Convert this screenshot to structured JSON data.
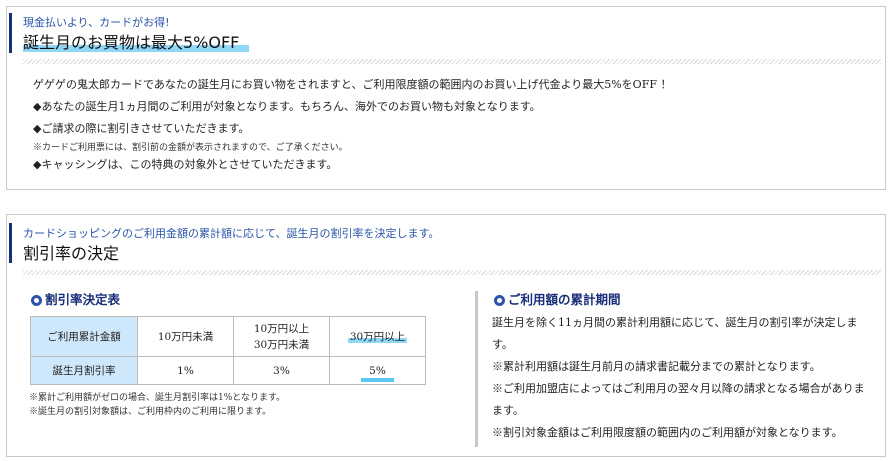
{
  "section1": {
    "subtitle": "現金払いより、カードがお得!",
    "title": "誕生月のお買物は最大5%OFF",
    "lines": [
      "ゲゲゲの鬼太郎カードであなたの誕生月にお買い物をされますと、ご利用限度額の範囲内のお買い上げ代金より最大5%をOFF ！",
      "◆あなたの誕生月1ヵ月間のご利用が対象となります。もちろん、海外でのお買い物も対象となります。",
      "◆ご請求の際に割引きさせていただきます。",
      "※カードご利用票には、割引前の金額が表示されますので、ご了承ください。",
      "◆キャッシングは、この特典の対象外とさせていただきます。"
    ]
  },
  "section2": {
    "subtitle": "カードショッピングのご利用金額の累計額に応じて、誕生月の割引率を決定します。",
    "title": "割引率の決定",
    "table_title": "割引率決定表",
    "table": {
      "row1": [
        "ご利用累計金額",
        "10万円未満",
        "10万円以上\n30万円未満",
        "30万円以上"
      ],
      "row2": [
        "誕生月割引率",
        "1%",
        "3%",
        "5%"
      ]
    },
    "table_notes": [
      "※累計ご利用額がゼロの場合、誕生月割引率は1%となります。",
      "※誕生月の割引対象額は、ご利用枠内のご利用に限ります。"
    ],
    "period_title": "ご利用額の累計期間",
    "period_lines": [
      "誕生月を除く11ヵ月間の累計利用額に応じて、誕生月の割引率が決定しま",
      "す。",
      "※累計利用額は誕生月前月の請求書記載分までの累計となります。",
      "※ご利用加盟店によってはご利用月の翌々月以降の請求となる場合がありま",
      "ます。",
      "※割引対象金額はご利用限度額の範囲内のご利用額が対象となります。"
    ]
  },
  "colors": {
    "accent": "#1a2f7a",
    "link_blue": "#2b54a8",
    "highlight": "#8fd7f5",
    "table_header": "#cfe7fb"
  }
}
